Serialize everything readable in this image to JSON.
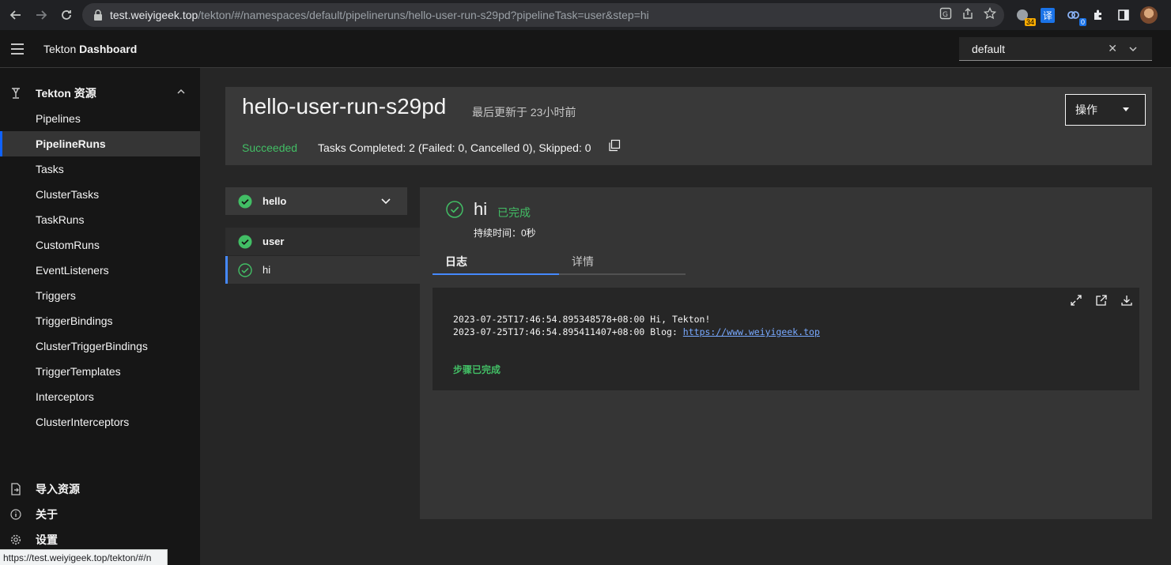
{
  "browser": {
    "url_host": "test.weiyigeek.top",
    "url_path": "/tekton/#/namespaces/default/pipelineruns/hello-user-run-s29pd?pipelineTask=user&step=hi",
    "ext_badge_1": "34",
    "ext_translate": "译",
    "ext_badge_2": "0",
    "status_url": "https://test.weiyigeek.top/tekton/#/n"
  },
  "header": {
    "brand_prefix": "Tekton ",
    "brand_bold": "Dashboard",
    "namespace": "default"
  },
  "sidebar": {
    "group_label": "Tekton 资源",
    "items": [
      {
        "label": "Pipelines"
      },
      {
        "label": "PipelineRuns"
      },
      {
        "label": "Tasks"
      },
      {
        "label": "ClusterTasks"
      },
      {
        "label": "TaskRuns"
      },
      {
        "label": "CustomRuns"
      },
      {
        "label": "EventListeners"
      },
      {
        "label": "Triggers"
      },
      {
        "label": "TriggerBindings"
      },
      {
        "label": "ClusterTriggerBindings"
      },
      {
        "label": "TriggerTemplates"
      },
      {
        "label": "Interceptors"
      },
      {
        "label": "ClusterInterceptors"
      }
    ],
    "import_label": "导入资源",
    "about_label": "关于",
    "settings_label": "设置"
  },
  "run": {
    "name": "hello-user-run-s29pd",
    "updated": "最后更新于 23小时前",
    "status": "Succeeded",
    "tasks_summary": "Tasks Completed: 2 (Failed: 0, Cancelled 0), Skipped: 0",
    "actions_label": "操作"
  },
  "task_tree": {
    "task_name": "hello",
    "steps": [
      {
        "name": "user"
      },
      {
        "name": "hi"
      }
    ]
  },
  "step": {
    "name": "hi",
    "state": "已完成",
    "duration": "持续时间：0秒",
    "tab_logs": "日志",
    "tab_details": "详情",
    "log_line_1": "2023-07-25T17:46:54.895348578+08:00 Hi, Tekton!",
    "log_line_2_prefix": "2023-07-25T17:46:54.895411407+08:00 Blog: ",
    "log_line_2_link": "https://www.weiyigeek.top",
    "log_done": "步骤已完成"
  },
  "colors": {
    "success": "#42be65",
    "accent": "#0f62fe",
    "link": "#78a9ff"
  }
}
